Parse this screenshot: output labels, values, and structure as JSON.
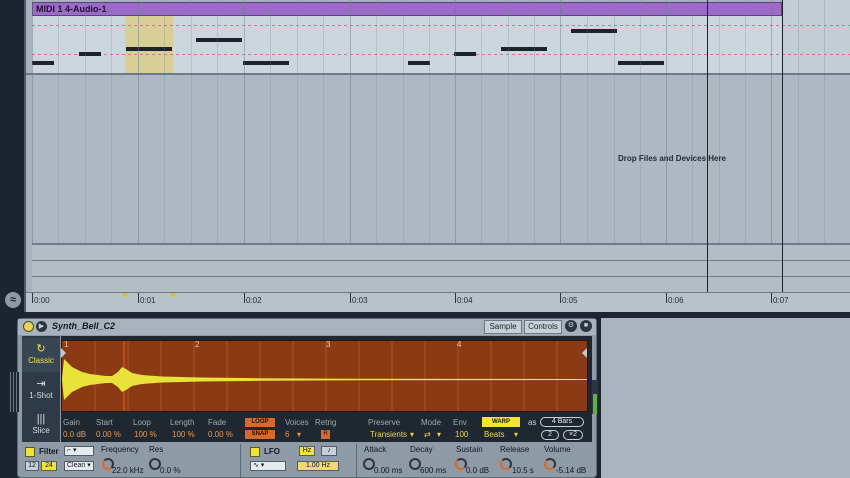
{
  "clip": {
    "name": "MIDI 1 4-Audio-1"
  },
  "arrangement": {
    "drop_text": "Drop Files and Devices Here",
    "ruler": [
      "0:00",
      "0:01",
      "0:02",
      "0:03",
      "0:04",
      "0:05",
      "0:06",
      "0:07"
    ]
  },
  "device": {
    "name": "Synth_Bell_C2",
    "tabs": [
      "Sample",
      "Controls"
    ],
    "modes": [
      {
        "label": "Classic",
        "icon": "loop-icon"
      },
      {
        "label": "1-Shot",
        "icon": "arrow-right-icon"
      },
      {
        "label": "Slice",
        "icon": "slice-icon"
      }
    ],
    "wave_ruler": [
      "1",
      "2",
      "3",
      "4"
    ],
    "params": {
      "gain_label": "Gain",
      "gain_value": "0.0 dB",
      "start_label": "Start",
      "start_value": "0.00 %",
      "loop_label": "Loop",
      "loop_value": "100 %",
      "length_label": "Length",
      "length_value": "100 %",
      "fade_label": "Fade",
      "fade_value": "0.00 %",
      "loop_btn": "LOOP",
      "snap_btn": "SNAP",
      "voices_label": "Voices",
      "voices_value": "6",
      "retrig_label": "Retrig",
      "retrig_value": "R",
      "preserve_label": "Preserve",
      "preserve_value": "Transients",
      "mode_label": "Mode",
      "mode_value": "⇄",
      "env_label": "Env",
      "env_value": "100",
      "warp_btn": "WARP",
      "as_label": "as",
      "bars_value": "4 Bars",
      "beats_value": "Beats",
      "half_btn": "2",
      "double_btn": "×2"
    },
    "filter": {
      "label": "Filter",
      "btn_12": "12",
      "btn_24": "24",
      "type_value": "Clean",
      "freq_label": "Frequency",
      "freq_value": "22.0 kHz",
      "res_label": "Res",
      "res_value": "0.0 %"
    },
    "lfo": {
      "label": "LFO",
      "hz_btn": "Hz",
      "note_btn": "♪",
      "rate_value": "1.00 Hz"
    },
    "envelope": {
      "attack_label": "Attack",
      "attack_value": "0.00 ms",
      "decay_label": "Decay",
      "decay_value": "600 ms",
      "sustain_label": "Sustain",
      "sustain_value": "0.0 dB",
      "release_label": "Release",
      "release_value": "10.5 s",
      "volume_label": "Volume",
      "volume_value": "-5.14 dB"
    }
  },
  "colors": {
    "clip_header": "#9c6bc8",
    "waveform_bg": "#8c3a13",
    "waveform": "#e8e23a",
    "accent_yellow": "#f2e337",
    "accent_orange": "#d9692a"
  }
}
